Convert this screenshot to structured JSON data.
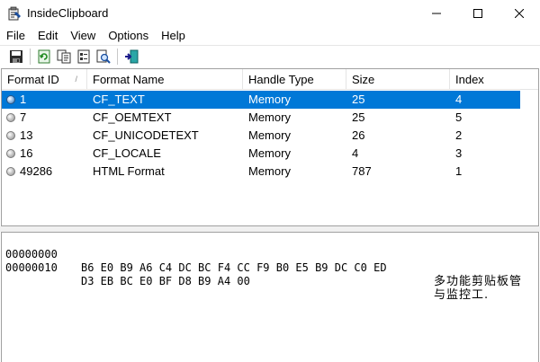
{
  "window": {
    "title": "InsideClipboard",
    "app_icon": "clipboard-app-icon",
    "controls": [
      "minimize-icon",
      "maximize-icon",
      "close-icon"
    ]
  },
  "menu": [
    "File",
    "Edit",
    "View",
    "Options",
    "Help"
  ],
  "toolbar": {
    "buttons": [
      "save-icon",
      "refresh-icon",
      "copy-icon",
      "properties-icon",
      "find-icon",
      "exit-icon"
    ]
  },
  "list": {
    "columns": [
      "Format ID",
      "Format Name",
      "Handle Type",
      "Size",
      "Index"
    ],
    "sort_indicator": "/",
    "rows": [
      {
        "format_id": "1",
        "format_name": "CF_TEXT",
        "handle_type": "Memory",
        "size": "25",
        "index": "4",
        "selected": true
      },
      {
        "format_id": "7",
        "format_name": "CF_OEMTEXT",
        "handle_type": "Memory",
        "size": "25",
        "index": "5",
        "selected": false
      },
      {
        "format_id": "13",
        "format_name": "CF_UNICODETEXT",
        "handle_type": "Memory",
        "size": "26",
        "index": "2",
        "selected": false
      },
      {
        "format_id": "16",
        "format_name": "CF_LOCALE",
        "handle_type": "Memory",
        "size": "4",
        "index": "3",
        "selected": false
      },
      {
        "format_id": "49286",
        "format_name": "HTML Format",
        "handle_type": "Memory",
        "size": "787",
        "index": "1",
        "selected": false
      }
    ]
  },
  "hex": {
    "lines": [
      {
        "offset": "00000000",
        "bytes": "B6 E0 B9 A6 C4 DC BC F4 CC F9 B0 E5 B9 DC C0 ED",
        "text": "多功能剪贴板管"
      },
      {
        "offset": "00000010",
        "bytes": "D3 EB BC E0 BF D8 B9 A4 00",
        "text": "与监控工."
      }
    ]
  },
  "colors": {
    "selection": "#0078d7",
    "border": "#a0a0a0"
  }
}
